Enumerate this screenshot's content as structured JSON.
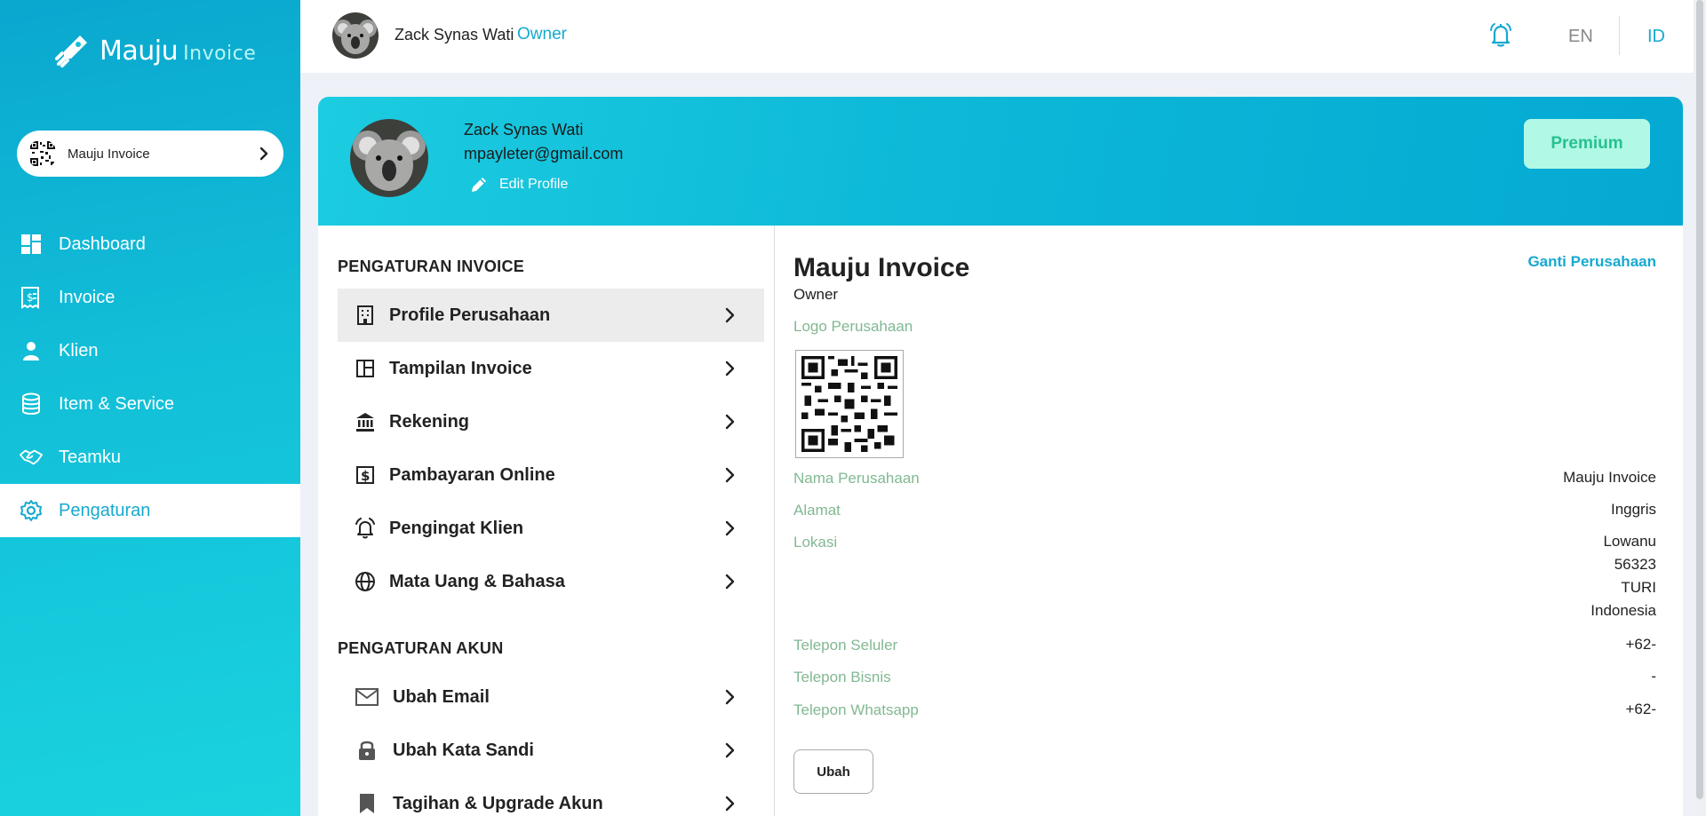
{
  "brand": {
    "name": "Mauju",
    "sub": "Invoice"
  },
  "sidebar": {
    "company": "Mauju Invoice",
    "items": [
      {
        "label": "Dashboard",
        "icon": "dashboard-icon"
      },
      {
        "label": "Invoice",
        "icon": "invoice-icon"
      },
      {
        "label": "Klien",
        "icon": "person-icon"
      },
      {
        "label": "Item & Service",
        "icon": "database-icon"
      },
      {
        "label": "Teamku",
        "icon": "handshake-icon"
      },
      {
        "label": "Pengaturan",
        "icon": "gear-icon",
        "active": true
      }
    ]
  },
  "topbar": {
    "user_name": "Zack Synas Wati",
    "role": "Owner",
    "lang_en": "EN",
    "lang_id": "ID",
    "active_lang": "ID"
  },
  "banner": {
    "name": "Zack Synas Wati",
    "email": "mpayleter@gmail.com",
    "edit_label": "Edit Profile",
    "premium_label": "Premium"
  },
  "settings": {
    "invoice_title": "PENGATURAN INVOICE",
    "invoice_items": [
      {
        "label": "Profile Perusahaan",
        "icon": "building-icon",
        "active": true
      },
      {
        "label": "Tampilan Invoice",
        "icon": "layout-icon"
      },
      {
        "label": "Rekening",
        "icon": "bank-icon"
      },
      {
        "label": "Pambayaran Online",
        "icon": "dollar-icon"
      },
      {
        "label": "Pengingat Klien",
        "icon": "alarm-icon"
      },
      {
        "label": "Mata Uang & Bahasa",
        "icon": "globe-icon"
      }
    ],
    "account_title": "PENGATURAN AKUN",
    "account_items": [
      {
        "label": "Ubah Email",
        "icon": "mail-icon"
      },
      {
        "label": "Ubah Kata Sandi",
        "icon": "lock-icon"
      },
      {
        "label": "Tagihan & Upgrade Akun",
        "icon": "bookmark-icon"
      }
    ]
  },
  "profile": {
    "company_name": "Mauju Invoice",
    "change_company": "Ganti Perusahaan",
    "role": "Owner",
    "logo_label": "Logo Perusahaan",
    "fields": [
      {
        "label": "Nama Perusahaan",
        "value": "Mauju Invoice"
      },
      {
        "label": "Alamat",
        "value": "Inggris"
      },
      {
        "label": "Lokasi",
        "lines": [
          "Lowanu",
          "56323",
          "TURI",
          "Indonesia"
        ]
      },
      {
        "label": "Telepon Seluler",
        "value": "+62-"
      },
      {
        "label": "Telepon Bisnis",
        "value": "-"
      },
      {
        "label": "Telepon Whatsapp",
        "value": "+62-"
      }
    ],
    "edit_button": "Ubah"
  },
  "colors": {
    "accent": "#17a9cf",
    "premium_bg": "#b2f8e6",
    "premium_text": "#27c18f",
    "label_green": "#82b892"
  }
}
